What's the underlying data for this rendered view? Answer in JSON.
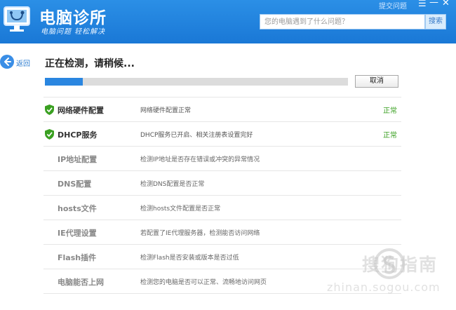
{
  "app": {
    "title": "电脑诊所",
    "subtitle": "电脑问题 轻松解决",
    "top_feedback": "提交问题",
    "menu_glyph": "☰",
    "min_glyph": "—",
    "close_glyph": "✕"
  },
  "search": {
    "placeholder": "您的电脑遇到了什么问题？",
    "button_label": "搜索"
  },
  "nav": {
    "back_label": "返回"
  },
  "scan": {
    "status_title": "正在检测，请稍候...",
    "progress": 0.125,
    "cancel_label": "取消"
  },
  "checks": [
    {
      "name": "网络硬件配置",
      "desc": "网络硬件配置正常",
      "status": "正常",
      "done": true
    },
    {
      "name": "DHCP服务",
      "desc": "DHCP服务已开启、相关注册表设置完好",
      "status": "正常",
      "done": true
    },
    {
      "name": "IP地址配置",
      "desc": "检测IP地址是否存在错误或冲突的异常情况",
      "status": "",
      "done": false
    },
    {
      "name": "DNS配置",
      "desc": "检测DNS配置是否正常",
      "status": "",
      "done": false
    },
    {
      "name": "hosts文件",
      "desc": "检测hosts文件配置是否正常",
      "status": "",
      "done": false
    },
    {
      "name": "IE代理设置",
      "desc": "若配置了IE代理服务器，检测能否访问网络",
      "status": "",
      "done": false
    },
    {
      "name": "Flash插件",
      "desc": "检测Flash是否安装或版本是否过低",
      "status": "",
      "done": false
    },
    {
      "name": "电脑能否上网",
      "desc": "检测您的电脑是否可以正常、流畅地访问网页",
      "status": "",
      "done": false
    }
  ],
  "watermark": {
    "brand": "搜狗指南",
    "url": "zhinan.sogou.com"
  },
  "colors": {
    "header": "#1f82dd",
    "accent": "#2a86e0",
    "ok": "#3aa021"
  }
}
